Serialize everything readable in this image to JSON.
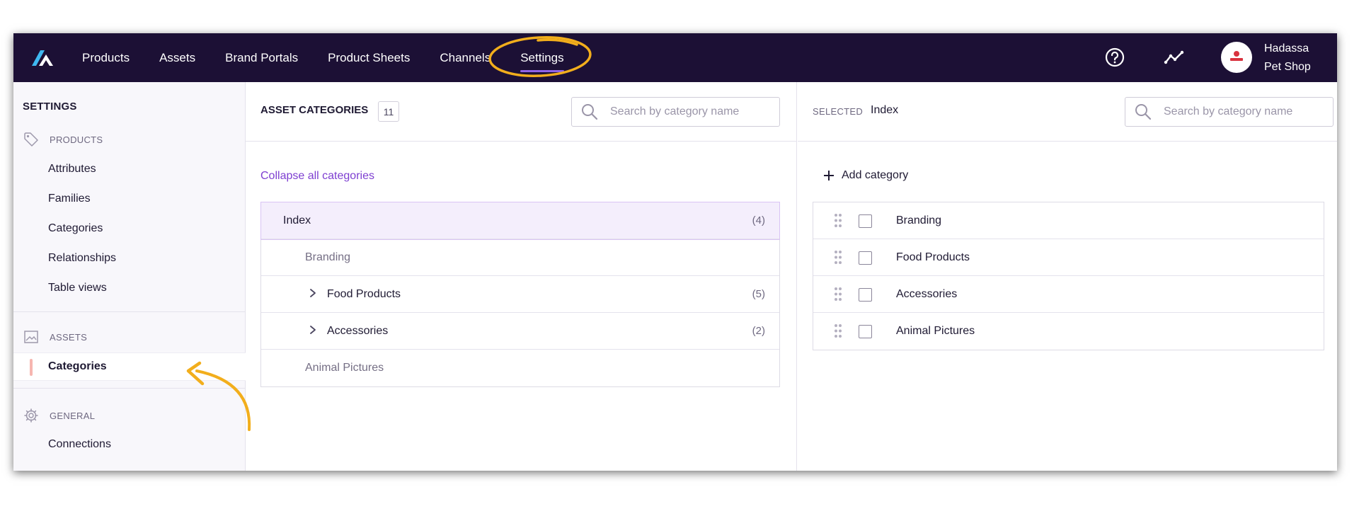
{
  "topbar": {
    "nav": [
      "Products",
      "Assets",
      "Brand Portals",
      "Product Sheets",
      "Channels",
      "Settings"
    ],
    "active_nav": "Settings",
    "help_icon": "help-circle-icon",
    "activity_icon": "activity-trend-icon",
    "user": {
      "name": "Hadassa",
      "org": "Pet Shop"
    }
  },
  "sidebar": {
    "title": "SETTINGS",
    "sections": {
      "products": {
        "label": "PRODUCTS",
        "icon": "tag-icon",
        "items": [
          "Attributes",
          "Families",
          "Categories",
          "Relationships",
          "Table views"
        ]
      },
      "assets": {
        "label": "ASSETS",
        "icon": "image-icon",
        "items": [
          "Categories"
        ]
      },
      "general": {
        "label": "GENERAL",
        "icon": "gear-icon",
        "items": [
          "Connections"
        ]
      }
    },
    "active_item": "Categories"
  },
  "middle": {
    "title": "ASSET CATEGORIES",
    "count": "11",
    "search_placeholder": "Search by category name",
    "collapse_label": "Collapse all categories",
    "tree": [
      {
        "label": "Index",
        "count": "(4)",
        "level": 0,
        "selected": true,
        "expandable": false
      },
      {
        "label": "Branding",
        "count": "",
        "level": 1,
        "selected": false,
        "expandable": false,
        "muted": true
      },
      {
        "label": "Food Products",
        "count": "(5)",
        "level": 1,
        "selected": false,
        "expandable": true
      },
      {
        "label": "Accessories",
        "count": "(2)",
        "level": 1,
        "selected": false,
        "expandable": true
      },
      {
        "label": "Animal Pictures",
        "count": "",
        "level": 1,
        "selected": false,
        "expandable": false,
        "muted": true
      }
    ]
  },
  "right": {
    "selected_label": "SELECTED",
    "selected_value": "Index",
    "search_placeholder": "Search by category name",
    "add_label": "Add category",
    "items": [
      "Branding",
      "Food Products",
      "Accessories",
      "Animal Pictures"
    ]
  },
  "colors": {
    "topbar": "#1c1035",
    "accent": "#8f63e8",
    "link": "#7e3fd1",
    "annotation": "#f2ae1c"
  }
}
